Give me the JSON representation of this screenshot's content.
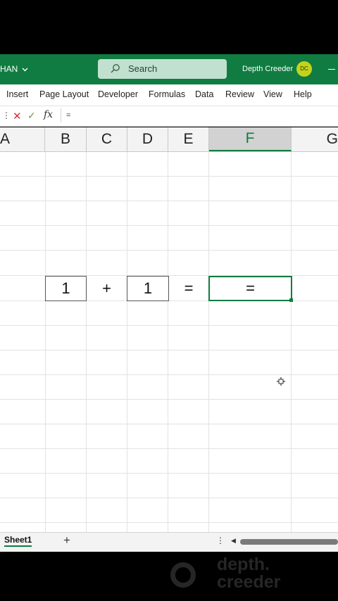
{
  "titlebar": {
    "left_text": "HAN",
    "search_label": "Search",
    "user_name": "Depth Creeder",
    "user_initials": "DC"
  },
  "ribbon": {
    "tabs": [
      "Insert",
      "Page Layout",
      "Developer",
      "Formulas",
      "Data",
      "Review",
      "View",
      "Help"
    ]
  },
  "formula_bar": {
    "fx_label": "fx",
    "value": "="
  },
  "columns": [
    "A",
    "B",
    "C",
    "D",
    "E",
    "F",
    "G"
  ],
  "active_column": "F",
  "cells": {
    "B": "1",
    "C": "+",
    "D": "1",
    "E": "=",
    "F": "="
  },
  "sheets": {
    "tabs": [
      "Sheet1"
    ],
    "add_label": "+"
  },
  "watermark": {
    "line1": "depth.",
    "line2": "creeder"
  },
  "colors": {
    "excel_green": "#107c41",
    "search_bg": "#c2e0cf",
    "avatar_bg": "#c3d31c"
  }
}
